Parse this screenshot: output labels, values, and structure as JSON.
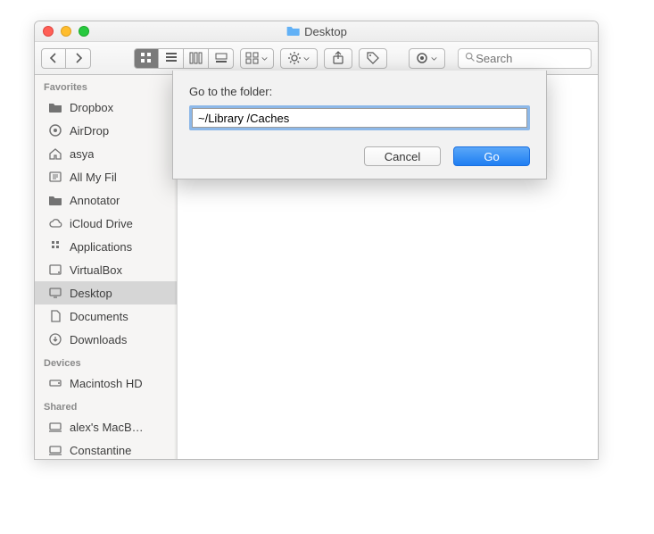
{
  "window": {
    "title": "Desktop"
  },
  "toolbar": {
    "search_placeholder": "Search"
  },
  "sidebar": {
    "sections": {
      "favorites": "Favorites",
      "devices": "Devices",
      "shared": "Shared"
    },
    "favorites": [
      {
        "label": "Dropbox",
        "icon": "folder-icon"
      },
      {
        "label": "AirDrop",
        "icon": "airdrop-icon"
      },
      {
        "label": "asya",
        "icon": "home-icon"
      },
      {
        "label": "All My Fil",
        "icon": "allfiles-icon"
      },
      {
        "label": "Annotator",
        "icon": "folder-icon"
      },
      {
        "label": "iCloud Drive",
        "icon": "cloud-icon"
      },
      {
        "label": "Applications",
        "icon": "applications-icon"
      },
      {
        "label": "VirtualBox",
        "icon": "disk-icon"
      },
      {
        "label": "Desktop",
        "icon": "desktop-icon",
        "selected": true
      },
      {
        "label": "Documents",
        "icon": "documents-icon"
      },
      {
        "label": "Downloads",
        "icon": "downloads-icon"
      }
    ],
    "devices": [
      {
        "label": "Macintosh HD",
        "icon": "hdd-icon"
      }
    ],
    "shared": [
      {
        "label": "alex's MacB…",
        "icon": "computer-icon"
      },
      {
        "label": "Constantine",
        "icon": "computer-icon"
      }
    ]
  },
  "sheet": {
    "label": "Go to the folder:",
    "value": "~/Library /Caches",
    "cancel": "Cancel",
    "go": "Go"
  }
}
